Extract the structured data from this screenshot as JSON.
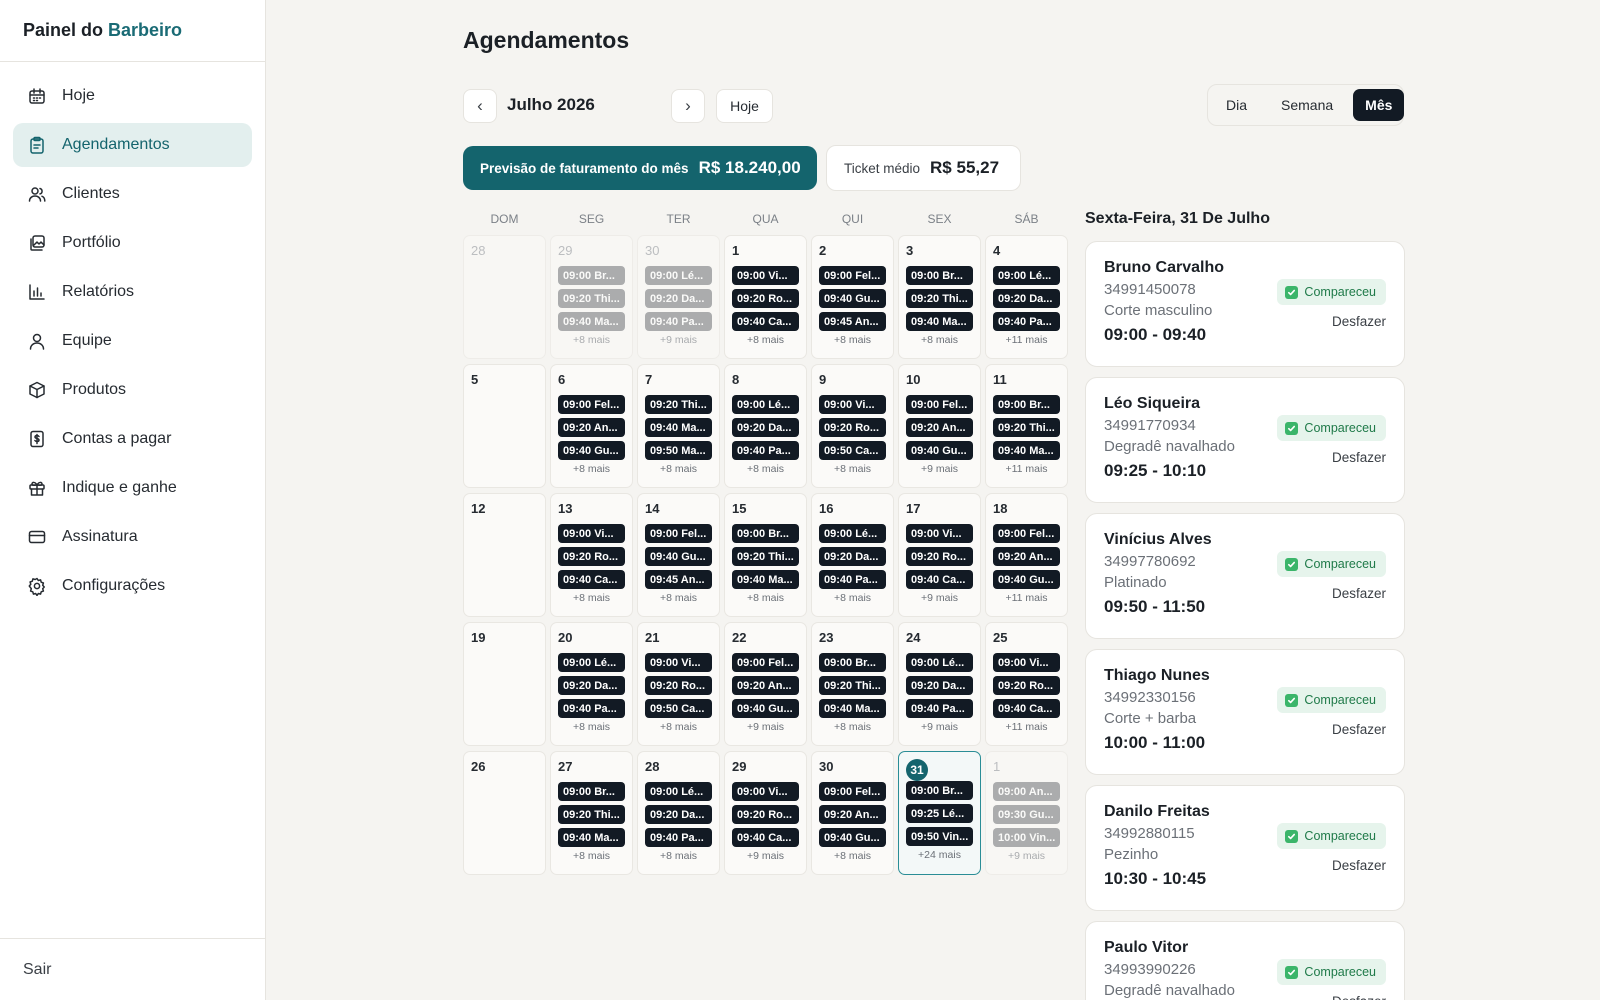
{
  "brand": {
    "prefix": "Painel do",
    "accent": "Barbeiro"
  },
  "sidebar": {
    "items": [
      {
        "label": "Hoje",
        "icon": "calendar-icon",
        "active": false
      },
      {
        "label": "Agendamentos",
        "icon": "clipboard-icon",
        "active": true
      },
      {
        "label": "Clientes",
        "icon": "users-icon",
        "active": false
      },
      {
        "label": "Portfólio",
        "icon": "gallery-icon",
        "active": false
      },
      {
        "label": "Relatórios",
        "icon": "bar-chart-icon",
        "active": false
      },
      {
        "label": "Equipe",
        "icon": "user-icon",
        "active": false
      },
      {
        "label": "Produtos",
        "icon": "box-icon",
        "active": false
      },
      {
        "label": "Contas a pagar",
        "icon": "dollar-doc-icon",
        "active": false
      },
      {
        "label": "Indique e ganhe",
        "icon": "gift-icon",
        "active": false
      },
      {
        "label": "Assinatura",
        "icon": "credit-card-icon",
        "active": false
      },
      {
        "label": "Configurações",
        "icon": "gear-icon",
        "active": false
      }
    ],
    "logout": "Sair"
  },
  "page": {
    "title": "Agendamentos"
  },
  "toolbar": {
    "month": "Julho 2026",
    "prev": "‹",
    "next": "›",
    "today": "Hoje",
    "views": [
      "Dia",
      "Semana",
      "Mês"
    ],
    "active_view": "Mês"
  },
  "summary": {
    "forecast_label": "Previsão de faturamento do mês",
    "forecast_value": "R$ 18.240,00",
    "ticket_label": "Ticket médio",
    "ticket_value": "R$ 55,27"
  },
  "calendar": {
    "weekdays": [
      "DOM",
      "SEG",
      "TER",
      "QUA",
      "QUI",
      "SEX",
      "SÁB"
    ],
    "weeks": [
      [
        {
          "day": "28",
          "other": true,
          "events": [],
          "more": ""
        },
        {
          "day": "29",
          "other": true,
          "events": [
            "09:00 Br...",
            "09:20 Thi...",
            "09:40 Ma..."
          ],
          "more": "+8 mais"
        },
        {
          "day": "30",
          "other": true,
          "events": [
            "09:00 Lé...",
            "09:20 Da...",
            "09:40 Pa..."
          ],
          "more": "+9 mais"
        },
        {
          "day": "1",
          "events": [
            "09:00 Vi...",
            "09:20 Ro...",
            "09:40 Ca..."
          ],
          "more": "+8 mais"
        },
        {
          "day": "2",
          "events": [
            "09:00 Fel...",
            "09:40 Gu...",
            "09:45 An..."
          ],
          "more": "+8 mais"
        },
        {
          "day": "3",
          "events": [
            "09:00 Br...",
            "09:20 Thi...",
            "09:40 Ma..."
          ],
          "more": "+8 mais"
        },
        {
          "day": "4",
          "events": [
            "09:00 Lé...",
            "09:20 Da...",
            "09:40 Pa..."
          ],
          "more": "+11 mais"
        }
      ],
      [
        {
          "day": "5",
          "events": [],
          "more": ""
        },
        {
          "day": "6",
          "events": [
            "09:00 Fel...",
            "09:20 An...",
            "09:40 Gu..."
          ],
          "more": "+8 mais"
        },
        {
          "day": "7",
          "events": [
            "09:20 Thi...",
            "09:40 Ma...",
            "09:50 Ma..."
          ],
          "more": "+8 mais"
        },
        {
          "day": "8",
          "events": [
            "09:00 Lé...",
            "09:20 Da...",
            "09:40 Pa..."
          ],
          "more": "+8 mais"
        },
        {
          "day": "9",
          "events": [
            "09:00 Vi...",
            "09:20 Ro...",
            "09:50 Ca..."
          ],
          "more": "+8 mais"
        },
        {
          "day": "10",
          "events": [
            "09:00 Fel...",
            "09:20 An...",
            "09:40 Gu..."
          ],
          "more": "+9 mais"
        },
        {
          "day": "11",
          "events": [
            "09:00 Br...",
            "09:20 Thi...",
            "09:40 Ma..."
          ],
          "more": "+11 mais"
        }
      ],
      [
        {
          "day": "12",
          "events": [],
          "more": ""
        },
        {
          "day": "13",
          "events": [
            "09:00 Vi...",
            "09:20 Ro...",
            "09:40 Ca..."
          ],
          "more": "+8 mais"
        },
        {
          "day": "14",
          "events": [
            "09:00 Fel...",
            "09:40 Gu...",
            "09:45 An..."
          ],
          "more": "+8 mais"
        },
        {
          "day": "15",
          "events": [
            "09:00 Br...",
            "09:20 Thi...",
            "09:40 Ma..."
          ],
          "more": "+8 mais"
        },
        {
          "day": "16",
          "events": [
            "09:00 Lé...",
            "09:20 Da...",
            "09:40 Pa..."
          ],
          "more": "+8 mais"
        },
        {
          "day": "17",
          "events": [
            "09:00 Vi...",
            "09:20 Ro...",
            "09:40 Ca..."
          ],
          "more": "+9 mais"
        },
        {
          "day": "18",
          "events": [
            "09:00 Fel...",
            "09:20 An...",
            "09:40 Gu..."
          ],
          "more": "+11 mais"
        }
      ],
      [
        {
          "day": "19",
          "events": [],
          "more": ""
        },
        {
          "day": "20",
          "events": [
            "09:00 Lé...",
            "09:20 Da...",
            "09:40 Pa..."
          ],
          "more": "+8 mais"
        },
        {
          "day": "21",
          "events": [
            "09:00 Vi...",
            "09:20 Ro...",
            "09:50 Ca..."
          ],
          "more": "+8 mais"
        },
        {
          "day": "22",
          "events": [
            "09:00 Fel...",
            "09:20 An...",
            "09:40 Gu..."
          ],
          "more": "+9 mais"
        },
        {
          "day": "23",
          "events": [
            "09:00 Br...",
            "09:20 Thi...",
            "09:40 Ma..."
          ],
          "more": "+8 mais"
        },
        {
          "day": "24",
          "events": [
            "09:00 Lé...",
            "09:20 Da...",
            "09:40 Pa..."
          ],
          "more": "+9 mais"
        },
        {
          "day": "25",
          "events": [
            "09:00 Vi...",
            "09:20 Ro...",
            "09:40 Ca..."
          ],
          "more": "+11 mais"
        }
      ],
      [
        {
          "day": "26",
          "events": [],
          "more": ""
        },
        {
          "day": "27",
          "events": [
            "09:00 Br...",
            "09:20 Thi...",
            "09:40 Ma..."
          ],
          "more": "+8 mais"
        },
        {
          "day": "28",
          "events": [
            "09:00 Lé...",
            "09:20 Da...",
            "09:40 Pa..."
          ],
          "more": "+8 mais"
        },
        {
          "day": "29",
          "events": [
            "09:00 Vi...",
            "09:20 Ro...",
            "09:40 Ca..."
          ],
          "more": "+9 mais"
        },
        {
          "day": "30",
          "events": [
            "09:00 Fel...",
            "09:20 An...",
            "09:40 Gu..."
          ],
          "more": "+8 mais"
        },
        {
          "day": "31",
          "today": true,
          "events": [
            "09:00 Br...",
            "09:25 Lé...",
            "09:50 Vin..."
          ],
          "more": "+24 mais"
        },
        {
          "day": "1",
          "other": true,
          "events": [
            "09:00 An...",
            "09:30 Gu...",
            "10:00 Vin..."
          ],
          "more": "+9 mais"
        }
      ]
    ]
  },
  "day_panel": {
    "title": "Sexta-Feira, 31 De Julho",
    "status_label": "Compareceu",
    "undo_label": "Desfazer",
    "appointments": [
      {
        "name": "Bruno Carvalho",
        "phone": "34991450078",
        "service": "Corte masculino",
        "time": "09:00 - 09:40"
      },
      {
        "name": "Léo Siqueira",
        "phone": "34991770934",
        "service": "Degradê navalhado",
        "time": "09:25 - 10:10"
      },
      {
        "name": "Vinícius Alves",
        "phone": "34997780692",
        "service": "Platinado",
        "time": "09:50 - 11:50"
      },
      {
        "name": "Thiago Nunes",
        "phone": "34992330156",
        "service": "Corte + barba",
        "time": "10:00 - 11:00"
      },
      {
        "name": "Danilo Freitas",
        "phone": "34992880115",
        "service": "Pezinho",
        "time": "10:30 - 10:45"
      },
      {
        "name": "Paulo Vitor",
        "phone": "34993990226",
        "service": "Degradê navalhado",
        "time": ""
      }
    ]
  },
  "colors": {
    "accent": "#14646d",
    "dark": "#121a24",
    "success": "#3bb56a"
  }
}
